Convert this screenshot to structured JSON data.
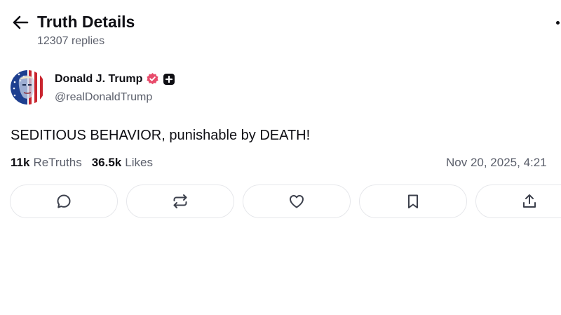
{
  "header": {
    "title": "Truth Details",
    "subtitle": "12307 replies"
  },
  "author": {
    "name": "Donald J. Trump",
    "handle": "@realDonaldTrump"
  },
  "post": {
    "text": "SEDITIOUS BEHAVIOR, punishable by DEATH!"
  },
  "stats": {
    "retruths_count": "11k",
    "retruths_label": "ReTruths",
    "likes_count": "36.5k",
    "likes_label": "Likes",
    "timestamp": "Nov 20, 2025, 4:21"
  },
  "actions": {
    "icons": [
      "reply-icon",
      "retruth-icon",
      "like-icon",
      "bookmark-icon",
      "share-icon"
    ]
  },
  "colors": {
    "text_primary": "#0f0f14",
    "text_secondary": "#5b5f6b",
    "verified_badge": "#e84b6b",
    "button_border": "#e6e7eb"
  }
}
